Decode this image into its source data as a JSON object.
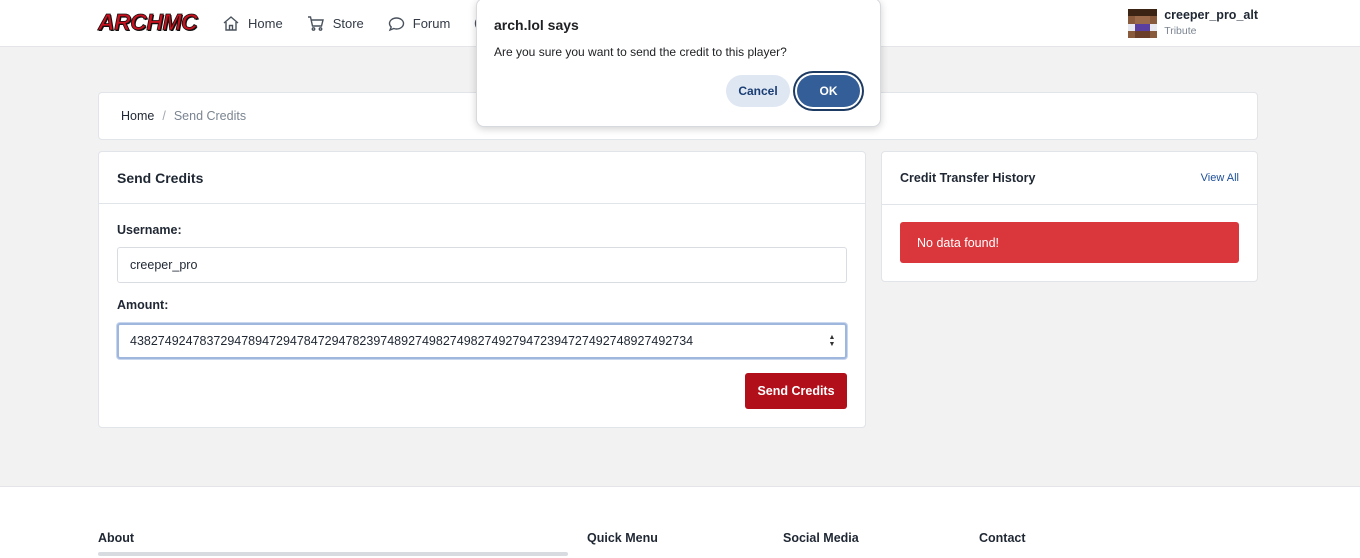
{
  "header": {
    "logo_text": "ARCHMC",
    "nav": [
      {
        "label": "Home",
        "icon": "home-icon"
      },
      {
        "label": "Store",
        "icon": "cart-icon"
      },
      {
        "label": "Forum",
        "icon": "chat-bubble-icon"
      },
      {
        "label": "",
        "icon": "support-lifebuoy-icon"
      }
    ],
    "user": {
      "name": "creeper_pro_alt",
      "rank": "Tribute"
    }
  },
  "breadcrumb": {
    "home": "Home",
    "separator": "/",
    "current": "Send Credits"
  },
  "send_credits": {
    "title": "Send Credits",
    "username_label": "Username:",
    "username_value": "creeper_pro",
    "amount_label": "Amount:",
    "amount_value": "438274924783729478947294784729478239748927498274982749279472394727492748927492734",
    "submit_label": "Send Credits"
  },
  "history": {
    "title": "Credit Transfer History",
    "view_all": "View All",
    "empty_message": "No data found!"
  },
  "footer": {
    "columns": [
      "About",
      "Quick Menu",
      "Social Media",
      "Contact"
    ]
  },
  "dialog": {
    "title": "arch.lol says",
    "message": "Are you sure you want to send the credit to this player?",
    "cancel_label": "Cancel",
    "ok_label": "OK"
  },
  "colors": {
    "brand_red": "#b1101b",
    "alert_red": "#d9373c",
    "dialog_ok": "#345e97",
    "link_blue": "#1d4f9a"
  }
}
